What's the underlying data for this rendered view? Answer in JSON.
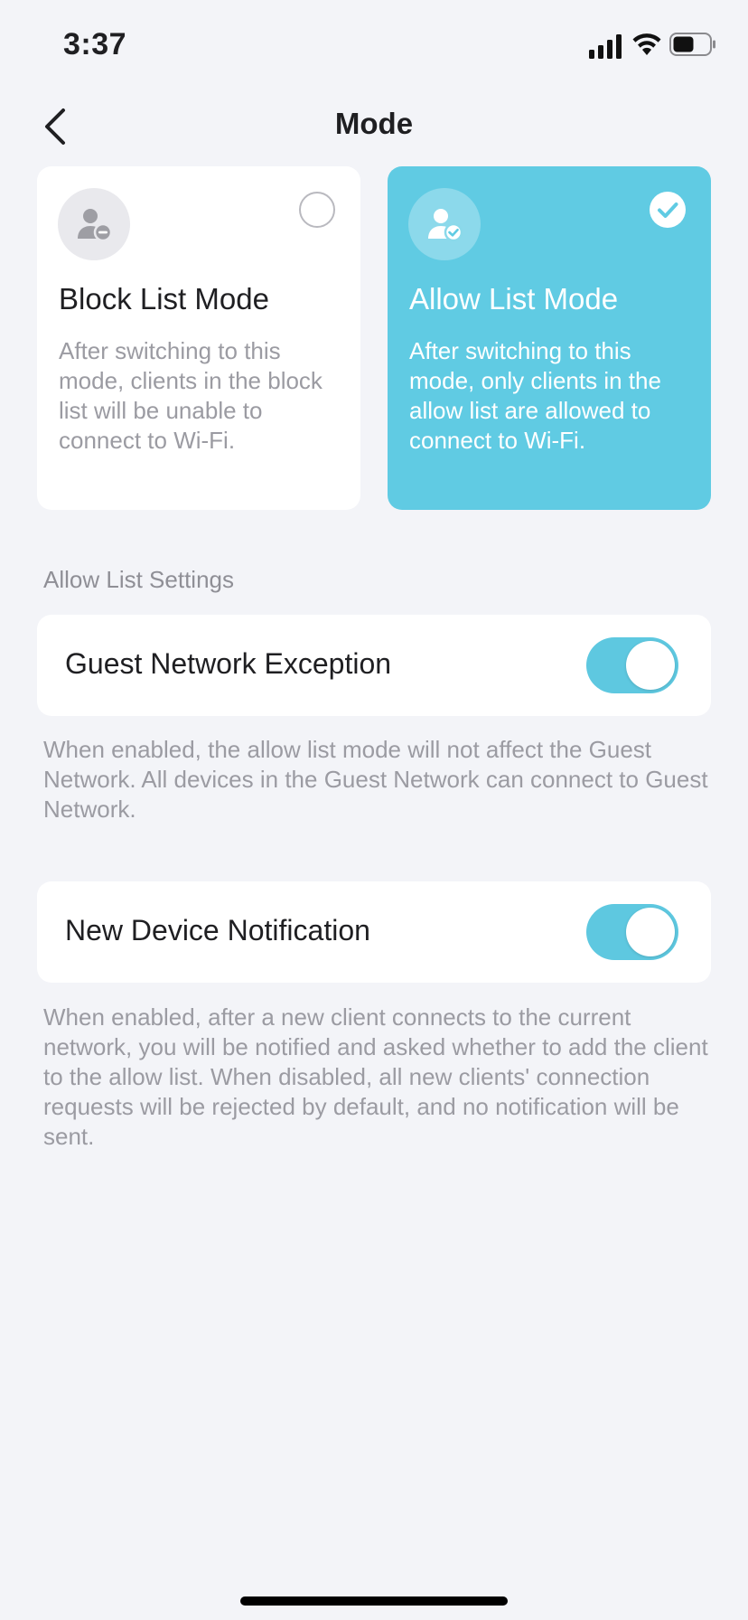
{
  "status_bar": {
    "time": "3:37"
  },
  "header": {
    "title": "Mode"
  },
  "modes": {
    "block": {
      "title": "Block List Mode",
      "description": "After switching to this mode, clients in the block list will be unable to connect to Wi-Fi.",
      "selected": false,
      "icon": "user-minus-icon"
    },
    "allow": {
      "title": "Allow List Mode",
      "description": "After switching to this mode, only clients in the allow list are allowed to connect to Wi-Fi.",
      "selected": true,
      "icon": "user-check-icon"
    }
  },
  "allow_list_settings": {
    "section_title": "Allow List Settings",
    "guest_network_exception": {
      "label": "Guest Network Exception",
      "enabled": true,
      "description": "When enabled, the allow list mode will not affect the Guest Network. All devices in the Guest Network can connect to Guest Network."
    },
    "new_device_notification": {
      "label": "New Device Notification",
      "enabled": true,
      "description": "When enabled, after a new client connects to the current network, you will be notified and asked whether to add the client to the allow list. When disabled, all new clients' connection requests will be rejected by default, and no notification will be sent."
    }
  },
  "colors": {
    "accent": "#60cbe3",
    "background": "#f3f4f8",
    "card": "#ffffff",
    "muted_text": "#9b9ba2"
  }
}
